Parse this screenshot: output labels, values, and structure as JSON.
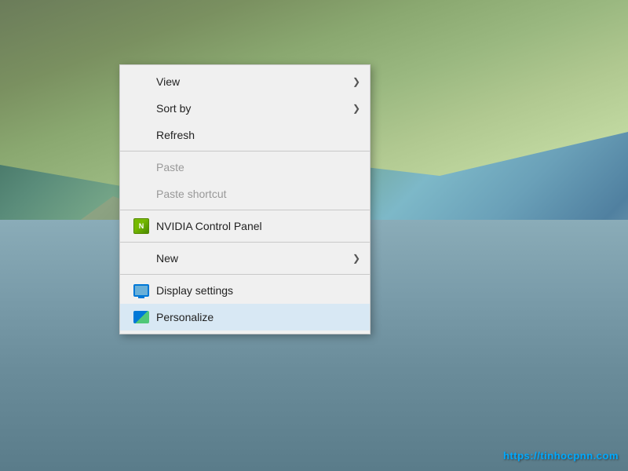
{
  "desktop": {
    "watermark": "https://tinhocpnn.com"
  },
  "context_menu": {
    "items": [
      {
        "id": "view",
        "label": "View",
        "type": "submenu",
        "disabled": false,
        "icon": null
      },
      {
        "id": "sort-by",
        "label": "Sort by",
        "type": "submenu",
        "disabled": false,
        "icon": null
      },
      {
        "id": "refresh",
        "label": "Refresh",
        "type": "action",
        "disabled": false,
        "icon": null
      },
      {
        "id": "sep1",
        "type": "separator"
      },
      {
        "id": "paste",
        "label": "Paste",
        "type": "action",
        "disabled": true,
        "icon": null
      },
      {
        "id": "paste-shortcut",
        "label": "Paste shortcut",
        "type": "action",
        "disabled": true,
        "icon": null
      },
      {
        "id": "sep2",
        "type": "separator"
      },
      {
        "id": "nvidia",
        "label": "NVIDIA Control Panel",
        "type": "action",
        "disabled": false,
        "icon": "nvidia"
      },
      {
        "id": "sep3",
        "type": "separator"
      },
      {
        "id": "new",
        "label": "New",
        "type": "submenu",
        "disabled": false,
        "icon": null
      },
      {
        "id": "sep4",
        "type": "separator"
      },
      {
        "id": "display-settings",
        "label": "Display settings",
        "type": "action",
        "disabled": false,
        "icon": "display"
      },
      {
        "id": "personalize",
        "label": "Personalize",
        "type": "action",
        "disabled": false,
        "icon": "personalize",
        "highlighted": true
      }
    ]
  }
}
